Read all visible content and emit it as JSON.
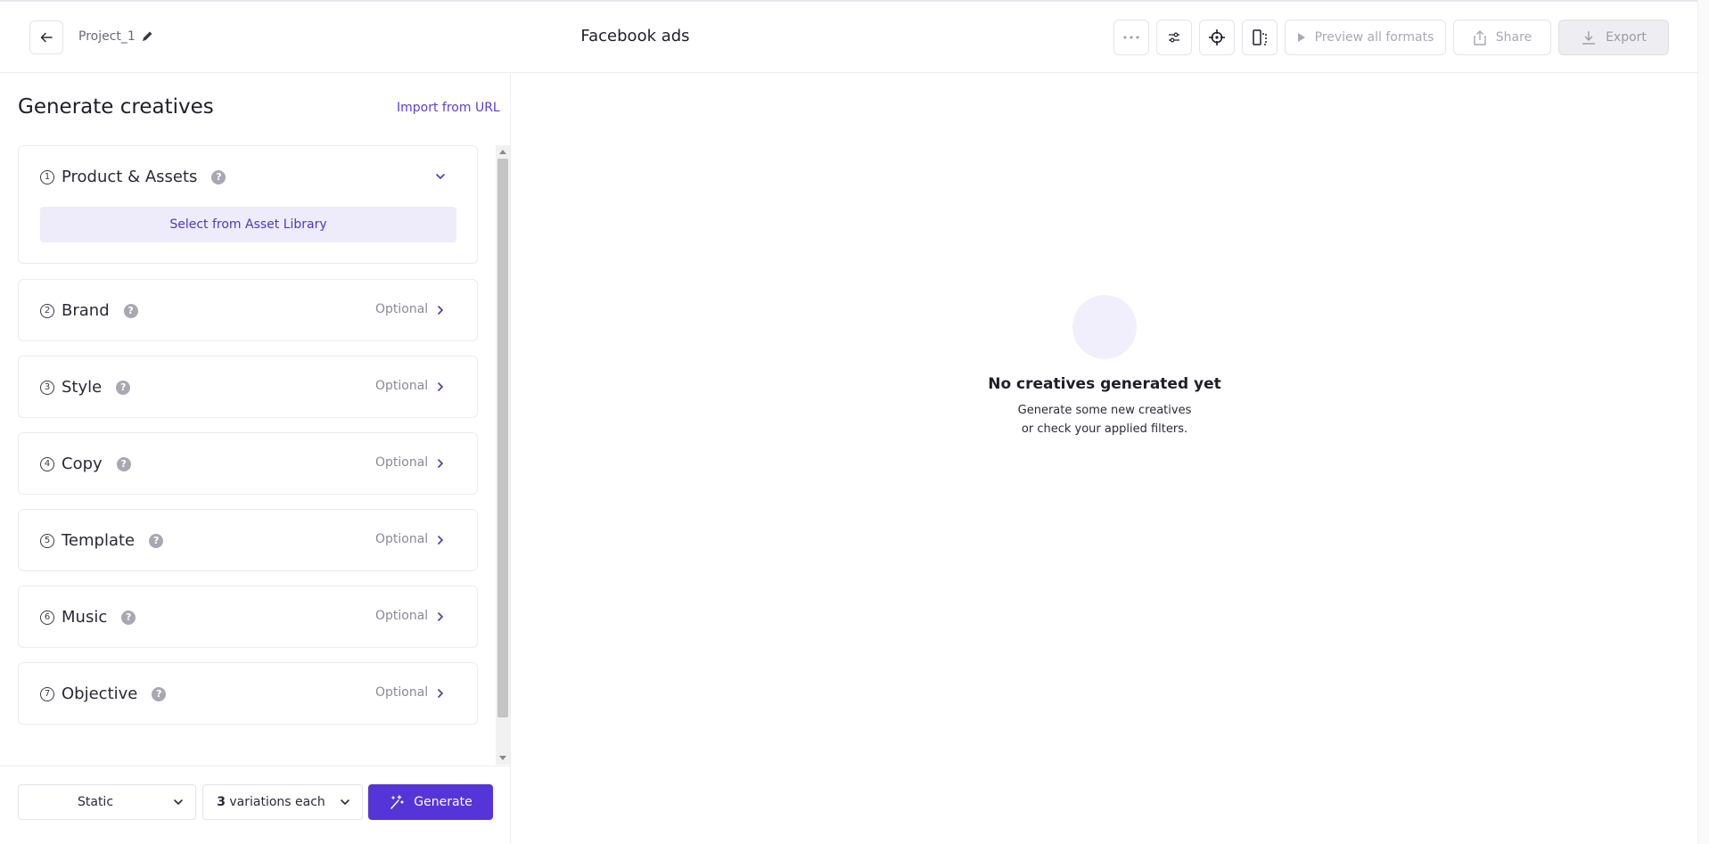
{
  "header": {
    "project_name": "Project_1",
    "title": "Facebook ads",
    "preview_label": "Preview all formats",
    "share_label": "Share",
    "export_label": "Export"
  },
  "left_panel": {
    "title": "Generate creatives",
    "import_label": "Import from URL",
    "sections": [
      {
        "num": "1",
        "label": "Product & Assets",
        "expanded": true,
        "action_label": "Select from Asset Library"
      },
      {
        "num": "2",
        "label": "Brand",
        "optional": "Optional"
      },
      {
        "num": "3",
        "label": "Style",
        "optional": "Optional"
      },
      {
        "num": "4",
        "label": "Copy",
        "optional": "Optional"
      },
      {
        "num": "5",
        "label": "Template",
        "optional": "Optional"
      },
      {
        "num": "6",
        "label": "Music",
        "optional": "Optional"
      },
      {
        "num": "7",
        "label": "Objective",
        "optional": "Optional"
      }
    ]
  },
  "bottom_bar": {
    "format_value": "Static",
    "variations_count": "3",
    "variations_suffix": "variations each",
    "generate_label": "Generate"
  },
  "empty_state": {
    "title": "No creatives generated yet",
    "line1": "Generate some new creatives",
    "line2": "or check your applied filters."
  },
  "colors": {
    "accent": "#5535d8",
    "accent_light": "#eeebfb"
  }
}
